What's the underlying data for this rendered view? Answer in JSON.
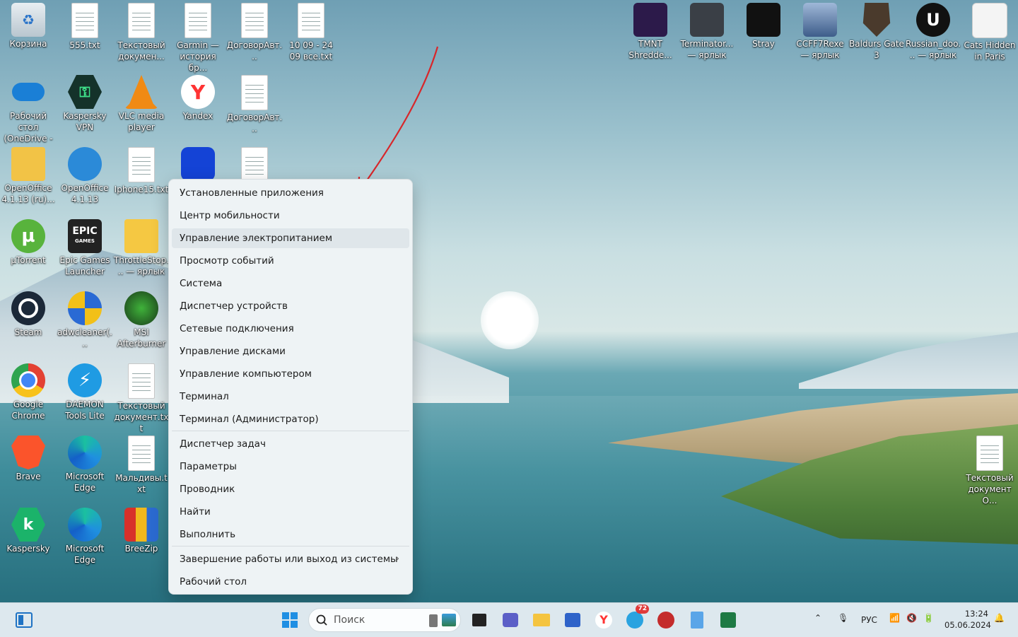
{
  "desktop_icons": [
    {
      "label": "Корзина"
    },
    {
      "label": "555.txt"
    },
    {
      "label": "Текстовый докумен..."
    },
    {
      "label": "Garmin — история бр..."
    },
    {
      "label": "ДоговорАвт..."
    },
    {
      "label": "10 09 - 24 09 все.txt"
    },
    {
      "label": "Рабочий стол (OneDrive - ..."
    },
    {
      "label": "Kaspersky VPN"
    },
    {
      "label": "VLC media player"
    },
    {
      "label": "Yandex"
    },
    {
      "label": "ДоговорАвт..."
    },
    {
      "label": "OpenOffice 4.1.13 (ru)..."
    },
    {
      "label": "OpenOffice 4.1.13"
    },
    {
      "label": "Iphone15.txt"
    },
    {
      "label": "µTorrent"
    },
    {
      "label": "Epic Games Launcher"
    },
    {
      "label": "ThrottleStop... — ярлык"
    },
    {
      "label": "Steam"
    },
    {
      "label": "adwcleaner(..."
    },
    {
      "label": "MSI Afterburner"
    },
    {
      "label": "Google Chrome"
    },
    {
      "label": "DAEMON Tools Lite"
    },
    {
      "label": "Текстовый документ.txt"
    },
    {
      "label": "Brave"
    },
    {
      "label": "Microsoft Edge"
    },
    {
      "label": "Мальдивы.txt"
    },
    {
      "label": "Kaspersky"
    },
    {
      "label": "Microsoft Edge"
    },
    {
      "label": "BreeZip"
    },
    {
      "label": "TMNT Shredde..."
    },
    {
      "label": "Terminator... — ярлык"
    },
    {
      "label": "Stray"
    },
    {
      "label": "CCFF7Rexe — ярлык"
    },
    {
      "label": "Baldurs Gate 3"
    },
    {
      "label": "Russian_doo... — ярлык"
    },
    {
      "label": "Cats Hidden in Paris"
    },
    {
      "label": "Текстовый документ О..."
    }
  ],
  "icon_logos": {
    "kaspersky_vpn": "⚿",
    "yandex": "Y",
    "epic": "EPIC",
    "epic_sub": "GAMES",
    "utorrent": "µ",
    "kaspersky": "k",
    "unreal": "U"
  },
  "context_menu": {
    "items": [
      {
        "label": "Установленные приложения"
      },
      {
        "label": "Центр мобильности"
      },
      {
        "label": "Управление электропитанием"
      },
      {
        "label": "Просмотр событий"
      },
      {
        "label": "Система"
      },
      {
        "label": "Диспетчер устройств"
      },
      {
        "label": "Сетевые подключения"
      },
      {
        "label": "Управление дисками"
      },
      {
        "label": "Управление компьютером"
      },
      {
        "label": "Терминал"
      },
      {
        "label": "Терминал (Администратор)"
      },
      {
        "label": "Диспетчер задач"
      },
      {
        "label": "Параметры"
      },
      {
        "label": "Проводник"
      },
      {
        "label": "Найти"
      },
      {
        "label": "Выполнить"
      },
      {
        "label": "Завершение работы или выход из системы"
      },
      {
        "label": "Рабочий стол"
      }
    ],
    "highlighted": "Управление электропитанием",
    "submenu_indicator": "›"
  },
  "taskbar": {
    "search_placeholder": "Поиск",
    "telegram_badge": "72",
    "language": "РУС",
    "time": "13:24",
    "date": "05.06.2024"
  },
  "colors": {
    "annotation_arrow": "#d8262a",
    "menu_bg": "#eef3f5",
    "taskbar_bg": "#dde8ee"
  }
}
